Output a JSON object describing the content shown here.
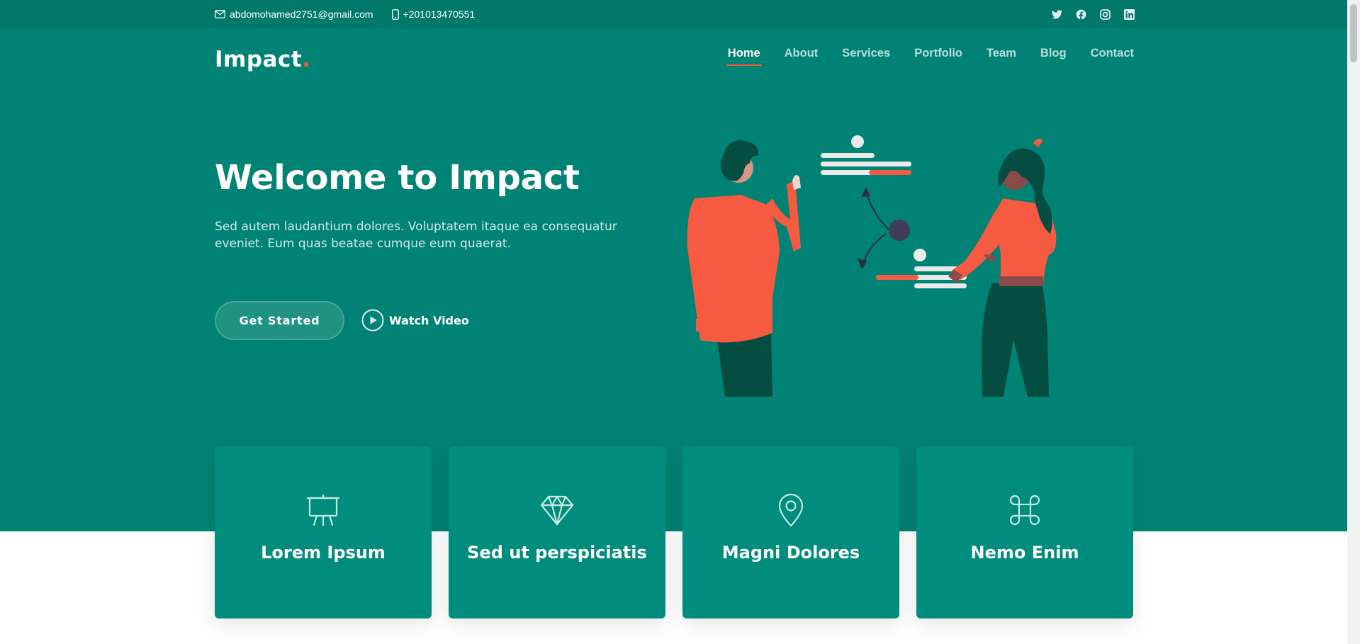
{
  "topbar": {
    "email": "abdomohamed2751@gmail.com",
    "phone": "+201013470551",
    "email_icon": "envelope-icon",
    "phone_icon": "phone-icon",
    "social": [
      "twitter-icon",
      "facebook-icon",
      "instagram-icon",
      "linkedin-icon"
    ]
  },
  "header": {
    "logo": "Impact",
    "logo_dot": ".",
    "nav": [
      "Home",
      "About",
      "Services",
      "Portfolio",
      "Team",
      "Blog",
      "Contact"
    ],
    "active": "Home"
  },
  "hero": {
    "title": "Welcome to Impact",
    "text": "Sed autem laudantium dolores. Voluptatem itaque ea consequatur eveniet. Eum quas beatae cumque eum quaerat.",
    "primary_button": "Get Started",
    "video_button": "Watch Video"
  },
  "cards": [
    {
      "title": "Lorem Ipsum",
      "icon": "easel-icon"
    },
    {
      "title": "Sed ut perspiciatis",
      "icon": "gem-icon"
    },
    {
      "title": "Magni Dolores",
      "icon": "geo-pin-icon"
    },
    {
      "title": "Nemo Enim",
      "icon": "command-icon"
    }
  ],
  "colors": {
    "topbar": "#00796b",
    "hero": "#008374",
    "card": "#008d7d",
    "accent": "#f85a40"
  }
}
